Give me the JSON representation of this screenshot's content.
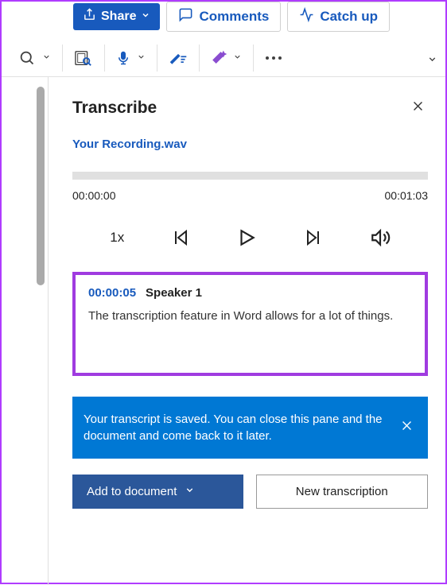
{
  "topbar": {
    "share": "Share",
    "comments": "Comments",
    "catchup": "Catch up"
  },
  "pane": {
    "title": "Transcribe",
    "filename": "Your Recording.wav"
  },
  "player": {
    "current": "00:00:00",
    "total": "00:01:03",
    "speed": "1x"
  },
  "segment": {
    "time": "00:00:05",
    "speaker": "Speaker 1",
    "text": "The transcription feature in Word allows for a lot of things."
  },
  "notice": {
    "text": "Your transcript is saved. You can close this pane and the document and come back to it later."
  },
  "actions": {
    "add": "Add to document",
    "new": "New transcription"
  }
}
